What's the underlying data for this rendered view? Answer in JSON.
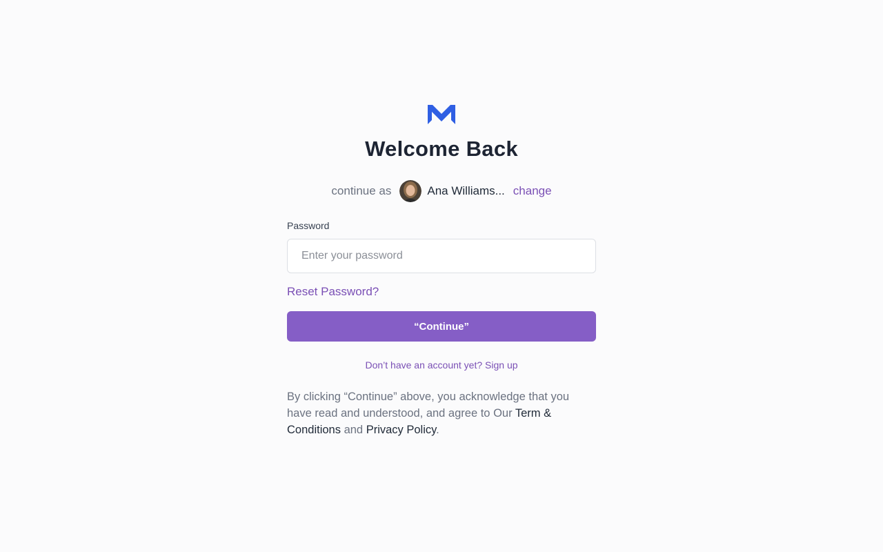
{
  "brand": {
    "logo_icon": "m-logo-icon",
    "accent_color": "#2f5fe3"
  },
  "header": {
    "title": "Welcome Back"
  },
  "account": {
    "prefix": "continue as",
    "name": "Ana Williams...",
    "change_label": "change",
    "avatar_icon": "user-avatar"
  },
  "form": {
    "password_label": "Password",
    "password_placeholder": "Enter your password",
    "password_value": "",
    "reset_label": "Reset Password?",
    "submit_label": "“Continue”"
  },
  "signup": {
    "prompt": "Don’t have an account yet?",
    "link_label": "Sign up"
  },
  "terms": {
    "text_before": "By clicking “Continue” above, you acknowledge that you have read and understood, and agree to Our",
    "terms_link": "Term & Conditions",
    "joiner": "and",
    "privacy_link": "Privacy Policy",
    "end": "."
  },
  "colors": {
    "primary": "#855ec6",
    "link": "#7a4fb5",
    "background": "#fbfbfc"
  }
}
